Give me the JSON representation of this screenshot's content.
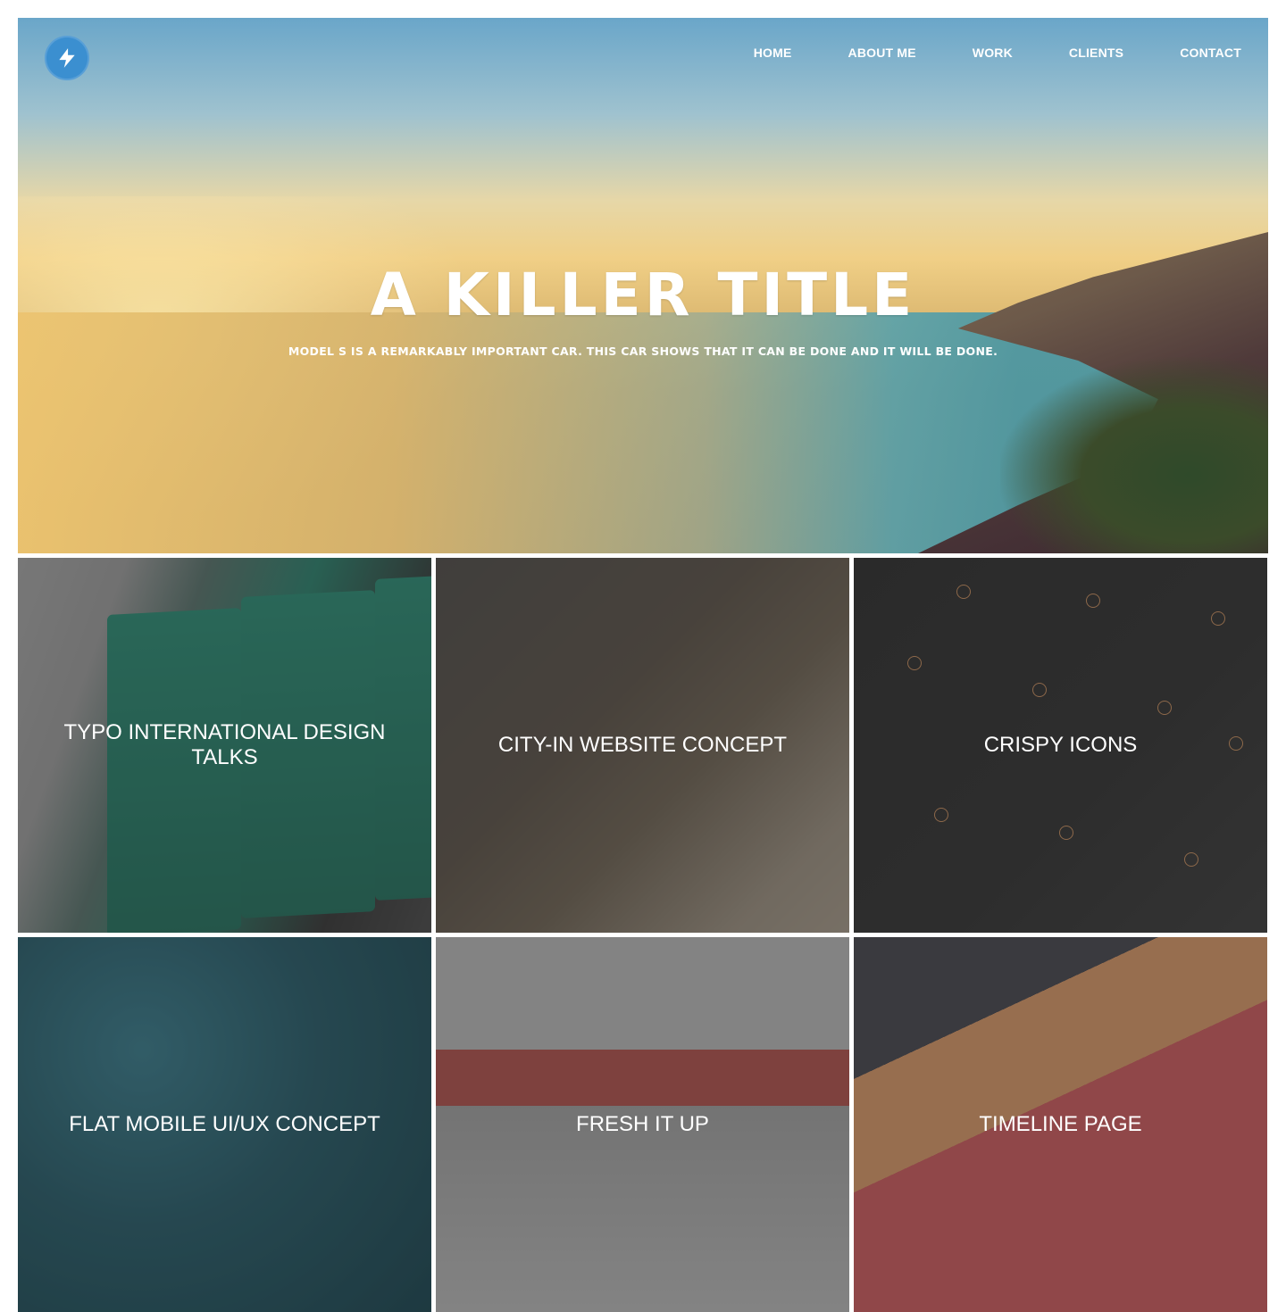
{
  "header": {
    "nav": [
      "HOME",
      "ABOUT ME",
      "WORK",
      "CLIENTS",
      "CONTACT"
    ],
    "logo_icon": "lightning-bolt-icon",
    "accent_color": "#3b8fd0"
  },
  "hero": {
    "title": "A KILLER TITLE",
    "subtitle": "MODEL S IS A REMARKABLY IMPORTANT CAR. THIS CAR SHOWS THAT IT CAN BE DONE AND IT WILL BE DONE."
  },
  "work": {
    "tiles": [
      {
        "label": "TYPO INTERNATIONAL DESIGN TALKS"
      },
      {
        "label": "CITY-IN WEBSITE CONCEPT"
      },
      {
        "label": "CRISPY ICONS"
      },
      {
        "label": "FLAT MOBILE UI/UX CONCEPT"
      },
      {
        "label": "FRESH IT UP"
      },
      {
        "label": "TIMELINE PAGE"
      }
    ]
  }
}
